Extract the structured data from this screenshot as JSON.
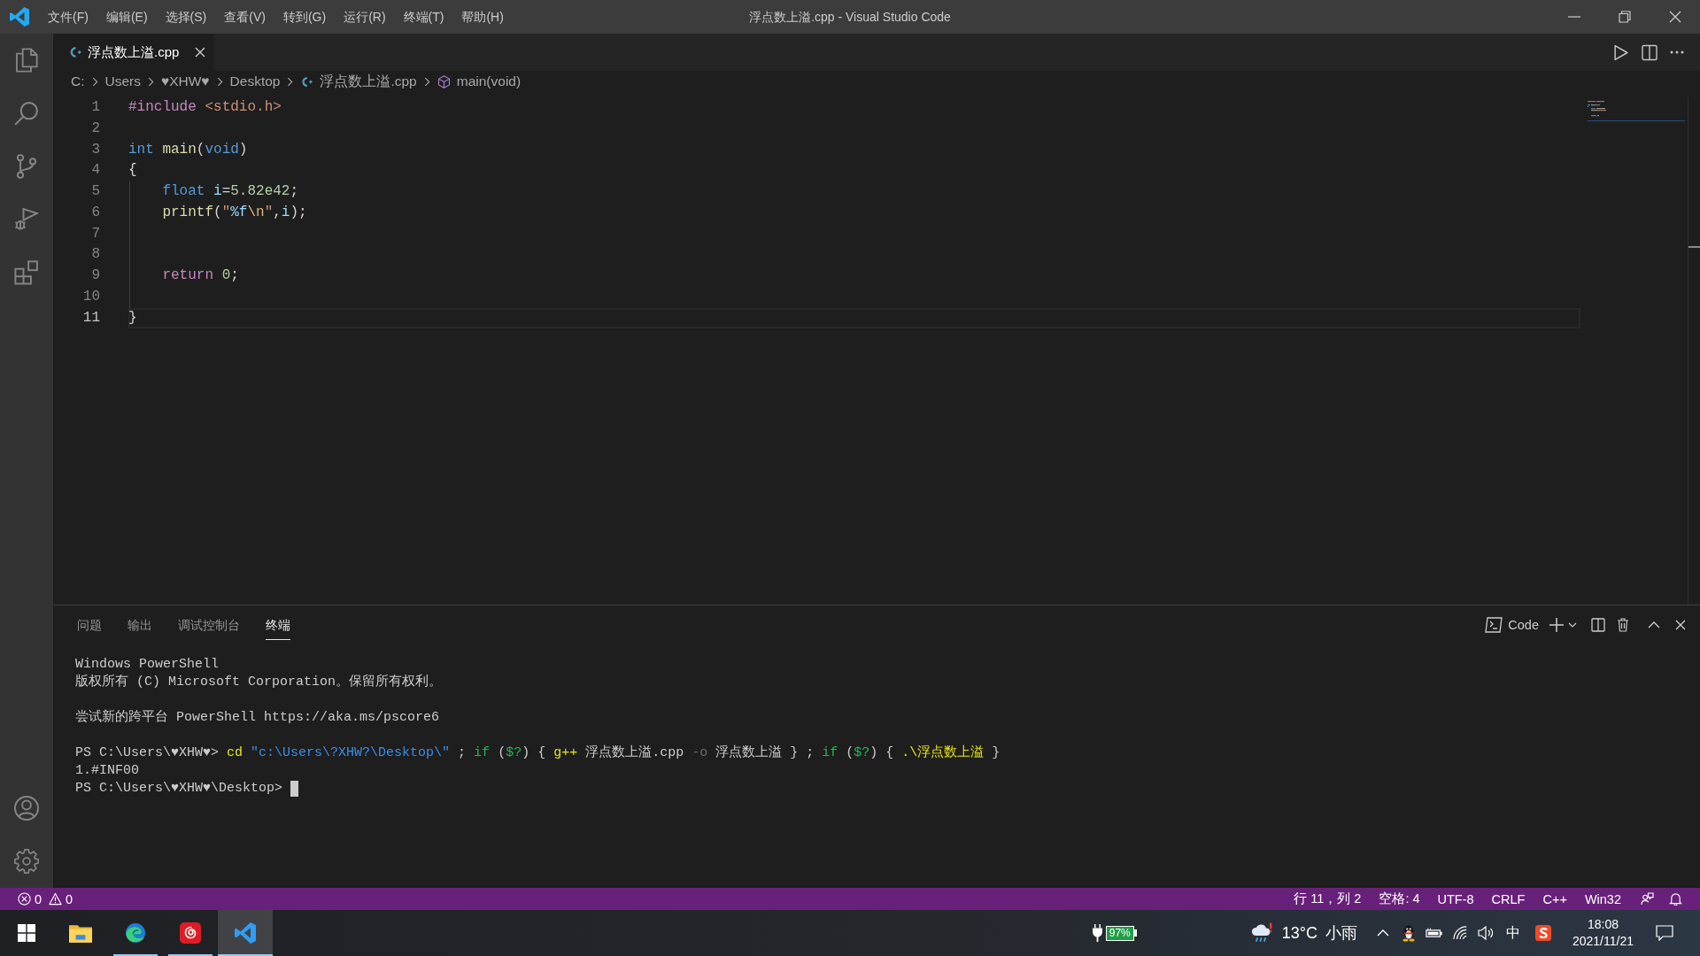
{
  "window": {
    "title": "浮点数上溢.cpp - Visual Studio Code"
  },
  "menu": [
    "文件(F)",
    "编辑(E)",
    "选择(S)",
    "查看(V)",
    "转到(G)",
    "运行(R)",
    "终端(T)",
    "帮助(H)"
  ],
  "tabs": [
    {
      "label": "浮点数上溢.cpp",
      "selected": true
    }
  ],
  "breadcrumb": [
    {
      "kind": "folder",
      "label": "C:"
    },
    {
      "kind": "folder",
      "label": "Users"
    },
    {
      "kind": "folder",
      "label": "♥XHW♥"
    },
    {
      "kind": "folder",
      "label": "Desktop"
    },
    {
      "kind": "file",
      "label": "浮点数上溢.cpp"
    },
    {
      "kind": "symbol",
      "label": "main(void)"
    }
  ],
  "editor": {
    "lines": [
      {
        "number": "1",
        "indented": false,
        "current": false,
        "tokens": [
          {
            "kind": "directive",
            "text": "#include "
          },
          {
            "kind": "string",
            "text": "<stdio.h>"
          }
        ]
      },
      {
        "number": "2",
        "indented": false,
        "current": false
      },
      {
        "number": "3",
        "indented": false,
        "current": false,
        "tokens": [
          {
            "kind": "keyword",
            "text": "int "
          },
          {
            "kind": "function",
            "text": "main"
          },
          {
            "kind": "plain",
            "text": "("
          },
          {
            "kind": "keyword",
            "text": "void"
          },
          {
            "kind": "plain",
            "text": ")"
          }
        ]
      },
      {
        "number": "4",
        "indented": false,
        "current": false,
        "tokens": [
          {
            "kind": "plain",
            "text": "{"
          }
        ]
      },
      {
        "number": "5",
        "indented": true,
        "current": false,
        "tokens": [
          {
            "kind": "keyword",
            "text": "float "
          },
          {
            "kind": "variable",
            "text": "i"
          },
          {
            "kind": "plain",
            "text": "="
          },
          {
            "kind": "number",
            "text": "5.82e42"
          },
          {
            "kind": "plain",
            "text": ";"
          }
        ]
      },
      {
        "number": "6",
        "indented": true,
        "current": false,
        "tokens": [
          {
            "kind": "function",
            "text": "printf"
          },
          {
            "kind": "plain",
            "text": "("
          },
          {
            "kind": "string",
            "text": "\""
          },
          {
            "kind": "format",
            "text": "%f"
          },
          {
            "kind": "escape",
            "text": "\\n"
          },
          {
            "kind": "string",
            "text": "\""
          },
          {
            "kind": "plain",
            "text": ","
          },
          {
            "kind": "variable",
            "text": "i"
          },
          {
            "kind": "plain",
            "text": ");"
          }
        ]
      },
      {
        "number": "7",
        "indented": true,
        "current": false
      },
      {
        "number": "8",
        "indented": true,
        "current": false
      },
      {
        "number": "9",
        "indented": true,
        "current": false,
        "tokens": [
          {
            "kind": "control",
            "text": "return "
          },
          {
            "kind": "number",
            "text": "0"
          },
          {
            "kind": "plain",
            "text": ";"
          }
        ]
      },
      {
        "number": "10",
        "indented": true,
        "current": false
      },
      {
        "number": "11",
        "indented": false,
        "current": true,
        "tokens": [
          {
            "kind": "plain",
            "text": "}"
          }
        ]
      }
    ]
  },
  "panel": {
    "tabs": [
      {
        "label": "问题",
        "selected": false
      },
      {
        "label": "输出",
        "selected": false
      },
      {
        "label": "调试控制台",
        "selected": false
      },
      {
        "label": "终端",
        "selected": true
      }
    ],
    "terminal_selector": "Code",
    "terminal": {
      "blocks": [
        [
          {
            "cursor": false,
            "segments": [
              {
                "kind": "plain",
                "text": "Windows PowerShell"
              }
            ]
          },
          {
            "cursor": false,
            "segments": [
              {
                "kind": "plain",
                "text": "版权所有 (C) Microsoft Corporation。保留所有权利。"
              }
            ]
          }
        ],
        [
          {
            "cursor": false,
            "segments": [
              {
                "kind": "plain",
                "text": "尝试新的跨平台 PowerShell https://aka.ms/pscore6"
              }
            ]
          }
        ],
        [
          {
            "cursor": false,
            "segments": [
              {
                "kind": "prompt",
                "text": "PS C:\\Users\\♥XHW♥> "
              },
              {
                "kind": "command",
                "text": "cd "
              },
              {
                "kind": "string",
                "text": "\"c:\\Users\\?XHW?\\Desktop\\\""
              },
              {
                "kind": "plain",
                "text": " ; "
              },
              {
                "kind": "keyword",
                "text": "if "
              },
              {
                "kind": "plain",
                "text": "("
              },
              {
                "kind": "variable",
                "text": "$?"
              },
              {
                "kind": "plain",
                "text": ") { "
              },
              {
                "kind": "command",
                "text": "g++ "
              },
              {
                "kind": "plain",
                "text": "浮点数上溢.cpp "
              },
              {
                "kind": "parameter",
                "text": "-o "
              },
              {
                "kind": "plain",
                "text": "浮点数上溢 } ; "
              },
              {
                "kind": "keyword",
                "text": "if "
              },
              {
                "kind": "plain",
                "text": "("
              },
              {
                "kind": "variable",
                "text": "$?"
              },
              {
                "kind": "plain",
                "text": ") { "
              },
              {
                "kind": "command",
                "text": ".\\浮点数上溢 "
              },
              {
                "kind": "plain",
                "text": "}"
              }
            ]
          },
          {
            "cursor": false,
            "segments": [
              {
                "kind": "plain",
                "text": "1.#INF00"
              }
            ]
          },
          {
            "cursor": true,
            "segments": [
              {
                "kind": "prompt",
                "text": "PS C:\\Users\\♥XHW♥\\Desktop> "
              }
            ]
          }
        ]
      ]
    }
  },
  "status_bar": {
    "errors": "0",
    "warnings": "0",
    "items": [
      "行 11，列 2",
      "空格: 4",
      "UTF-8",
      "CRLF",
      "C++",
      "Win32"
    ]
  },
  "taskbar": {
    "apps": [
      {
        "kind": "folder",
        "running": false,
        "selected": false
      },
      {
        "kind": "browser",
        "running": true,
        "selected": false
      },
      {
        "kind": "music",
        "running": true,
        "selected": false
      },
      {
        "kind": "editor",
        "running": true,
        "selected": true
      }
    ],
    "battery": "97%",
    "weather": {
      "temperature": "13°C",
      "condition": "小雨"
    },
    "input_method": "中",
    "clock": {
      "time": "18:08",
      "date": "2021/11/21"
    }
  }
}
